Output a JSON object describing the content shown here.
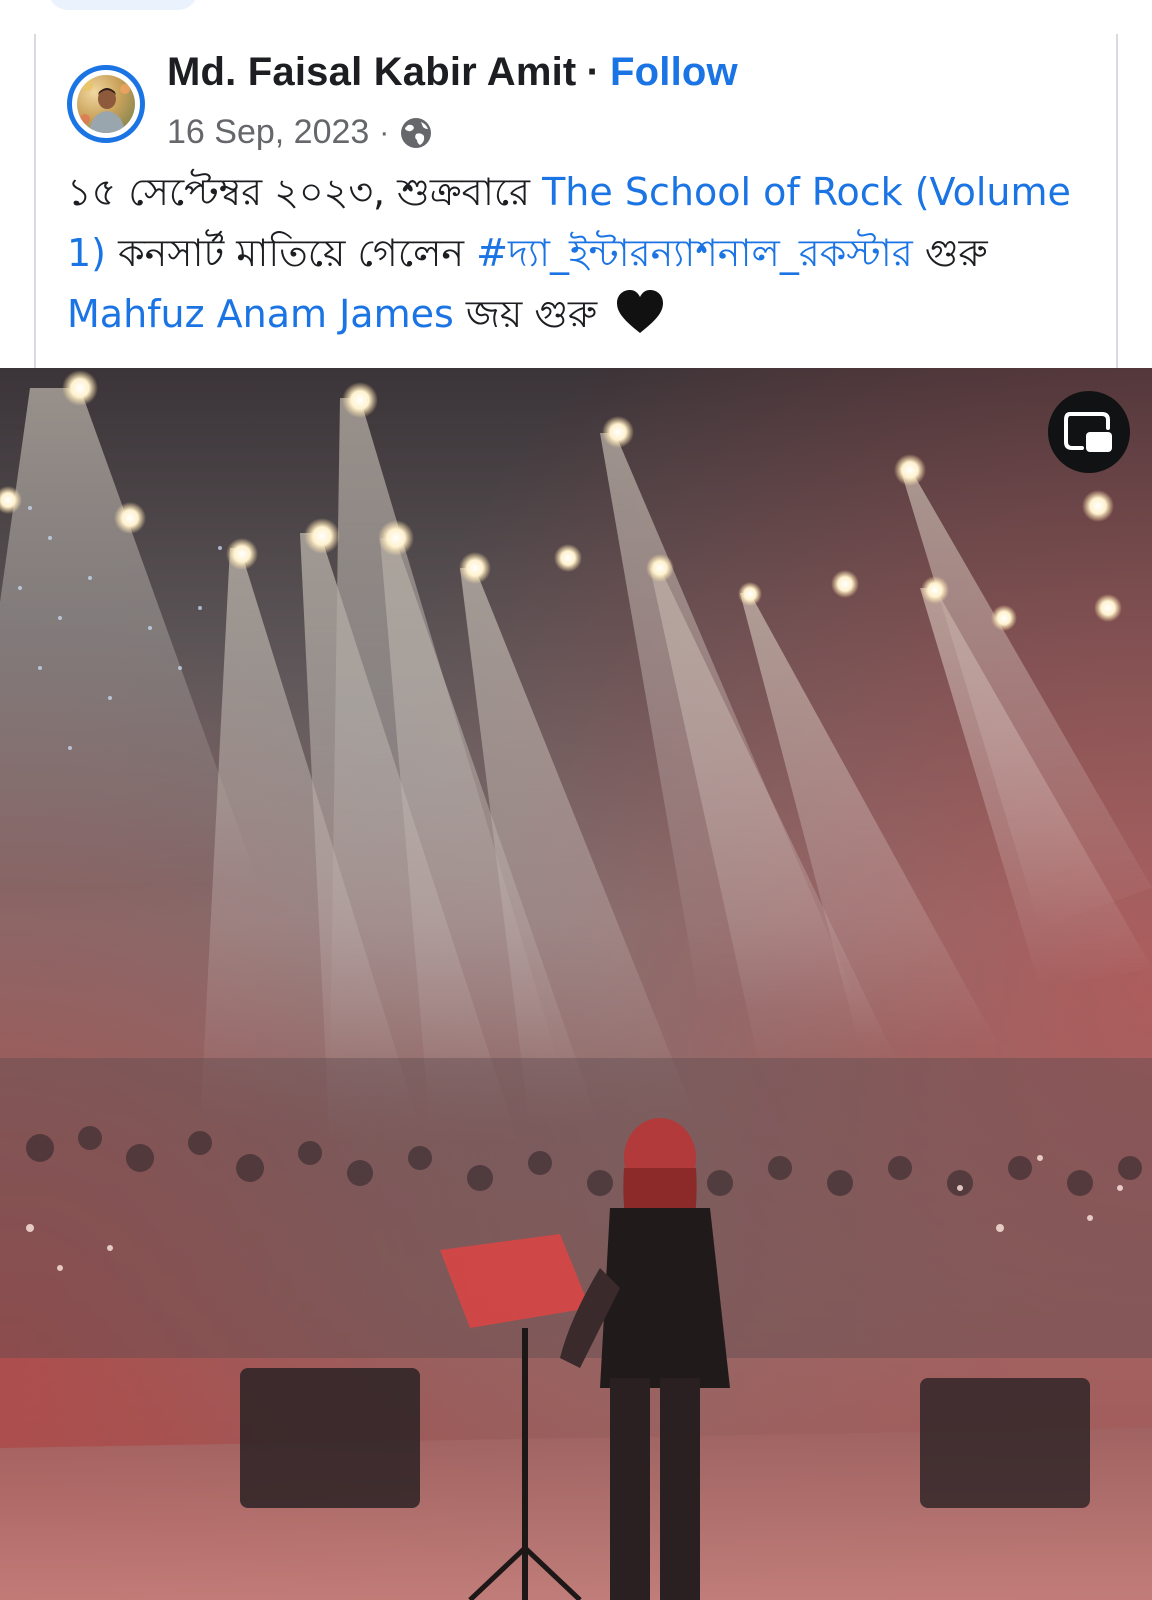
{
  "post": {
    "author": "Md. Faisal Kabir Amit",
    "separator": "·",
    "follow_label": "Follow",
    "date": "16 Sep, 2023",
    "audience_icon": "globe-icon",
    "text_parts": {
      "p1": "১৫ সেপ্টেম্বর ২০২৩, শুক্রবারে ",
      "link1": "The School of Rock (Volume 1)",
      "p2": " কনসার্ট মাতিয়ে গেলেন ",
      "hashtag": "#দ্যা_ইন্টারন্যাশনাল_রকস্টার",
      "p3": " গুরু ",
      "link2": "Mahfuz Anam James",
      "p4": " জয় গুরু "
    },
    "emoji": "black-heart-icon"
  },
  "video": {
    "content": "concert-stage-video",
    "pip_icon": "picture-in-picture-icon"
  },
  "colors": {
    "link": "#1b74e4",
    "text": "#1c1e21",
    "meta": "#65676b"
  }
}
